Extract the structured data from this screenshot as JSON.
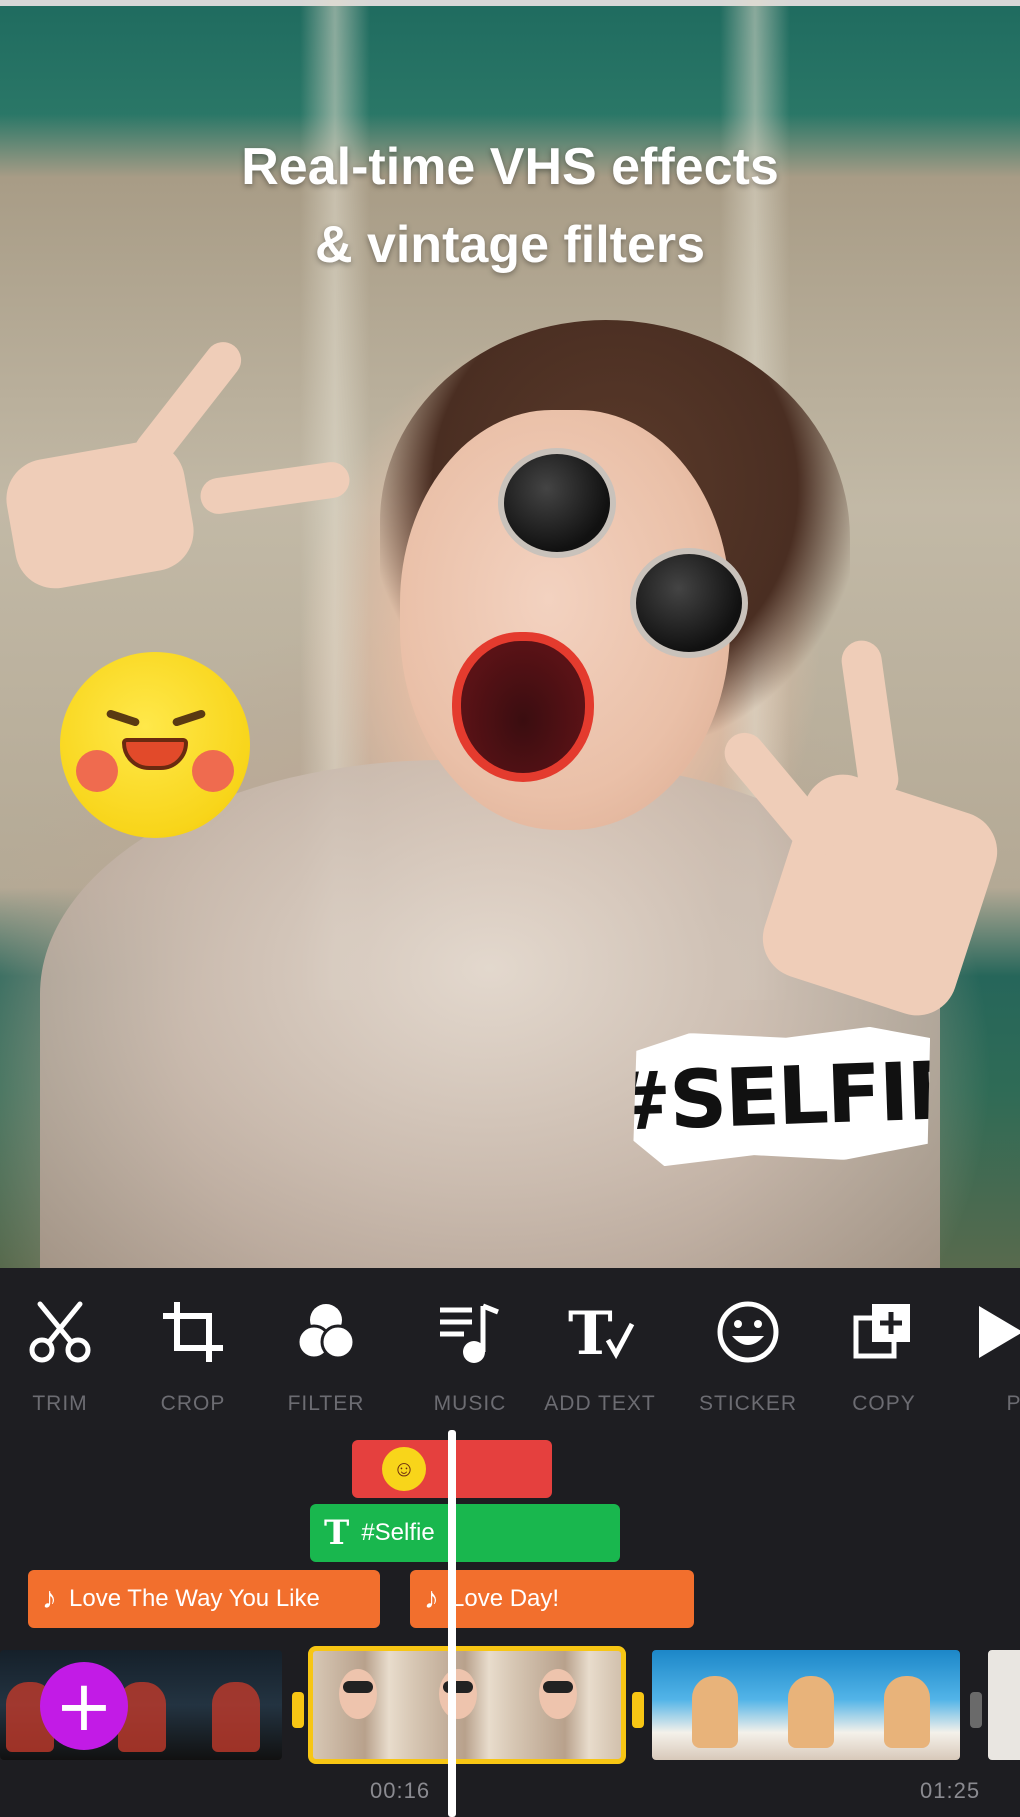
{
  "headline": {
    "line1": "Real-time VHS effects",
    "line2": "& vintage filters"
  },
  "stickers": {
    "hashtag": "#SELFIE",
    "emoji_icon": "laughing-emoji-icon"
  },
  "toolbar": {
    "items": [
      {
        "label": "TRIM",
        "icon": "scissors-icon"
      },
      {
        "label": "CROP",
        "icon": "crop-icon"
      },
      {
        "label": "FILTER",
        "icon": "filter-icon"
      },
      {
        "label": "MUSIC",
        "icon": "music-icon"
      },
      {
        "label": "ADD TEXT",
        "icon": "text-icon"
      },
      {
        "label": "STICKER",
        "icon": "smiley-icon"
      },
      {
        "label": "COPY",
        "icon": "copy-icon"
      },
      {
        "label": "P",
        "icon": "play-icon"
      }
    ]
  },
  "timeline": {
    "text_track": "#Selfie",
    "music_tracks": [
      "Love The Way You Like",
      "Love Day!"
    ],
    "current_time": "00:16",
    "end_time": "01:25",
    "add_label": "+"
  },
  "colors": {
    "sticker_track": "#e5403e",
    "text_track": "#19b74e",
    "music_track": "#f26f2d",
    "selected_clip": "#f7c614",
    "add_button": "#c21be6"
  }
}
